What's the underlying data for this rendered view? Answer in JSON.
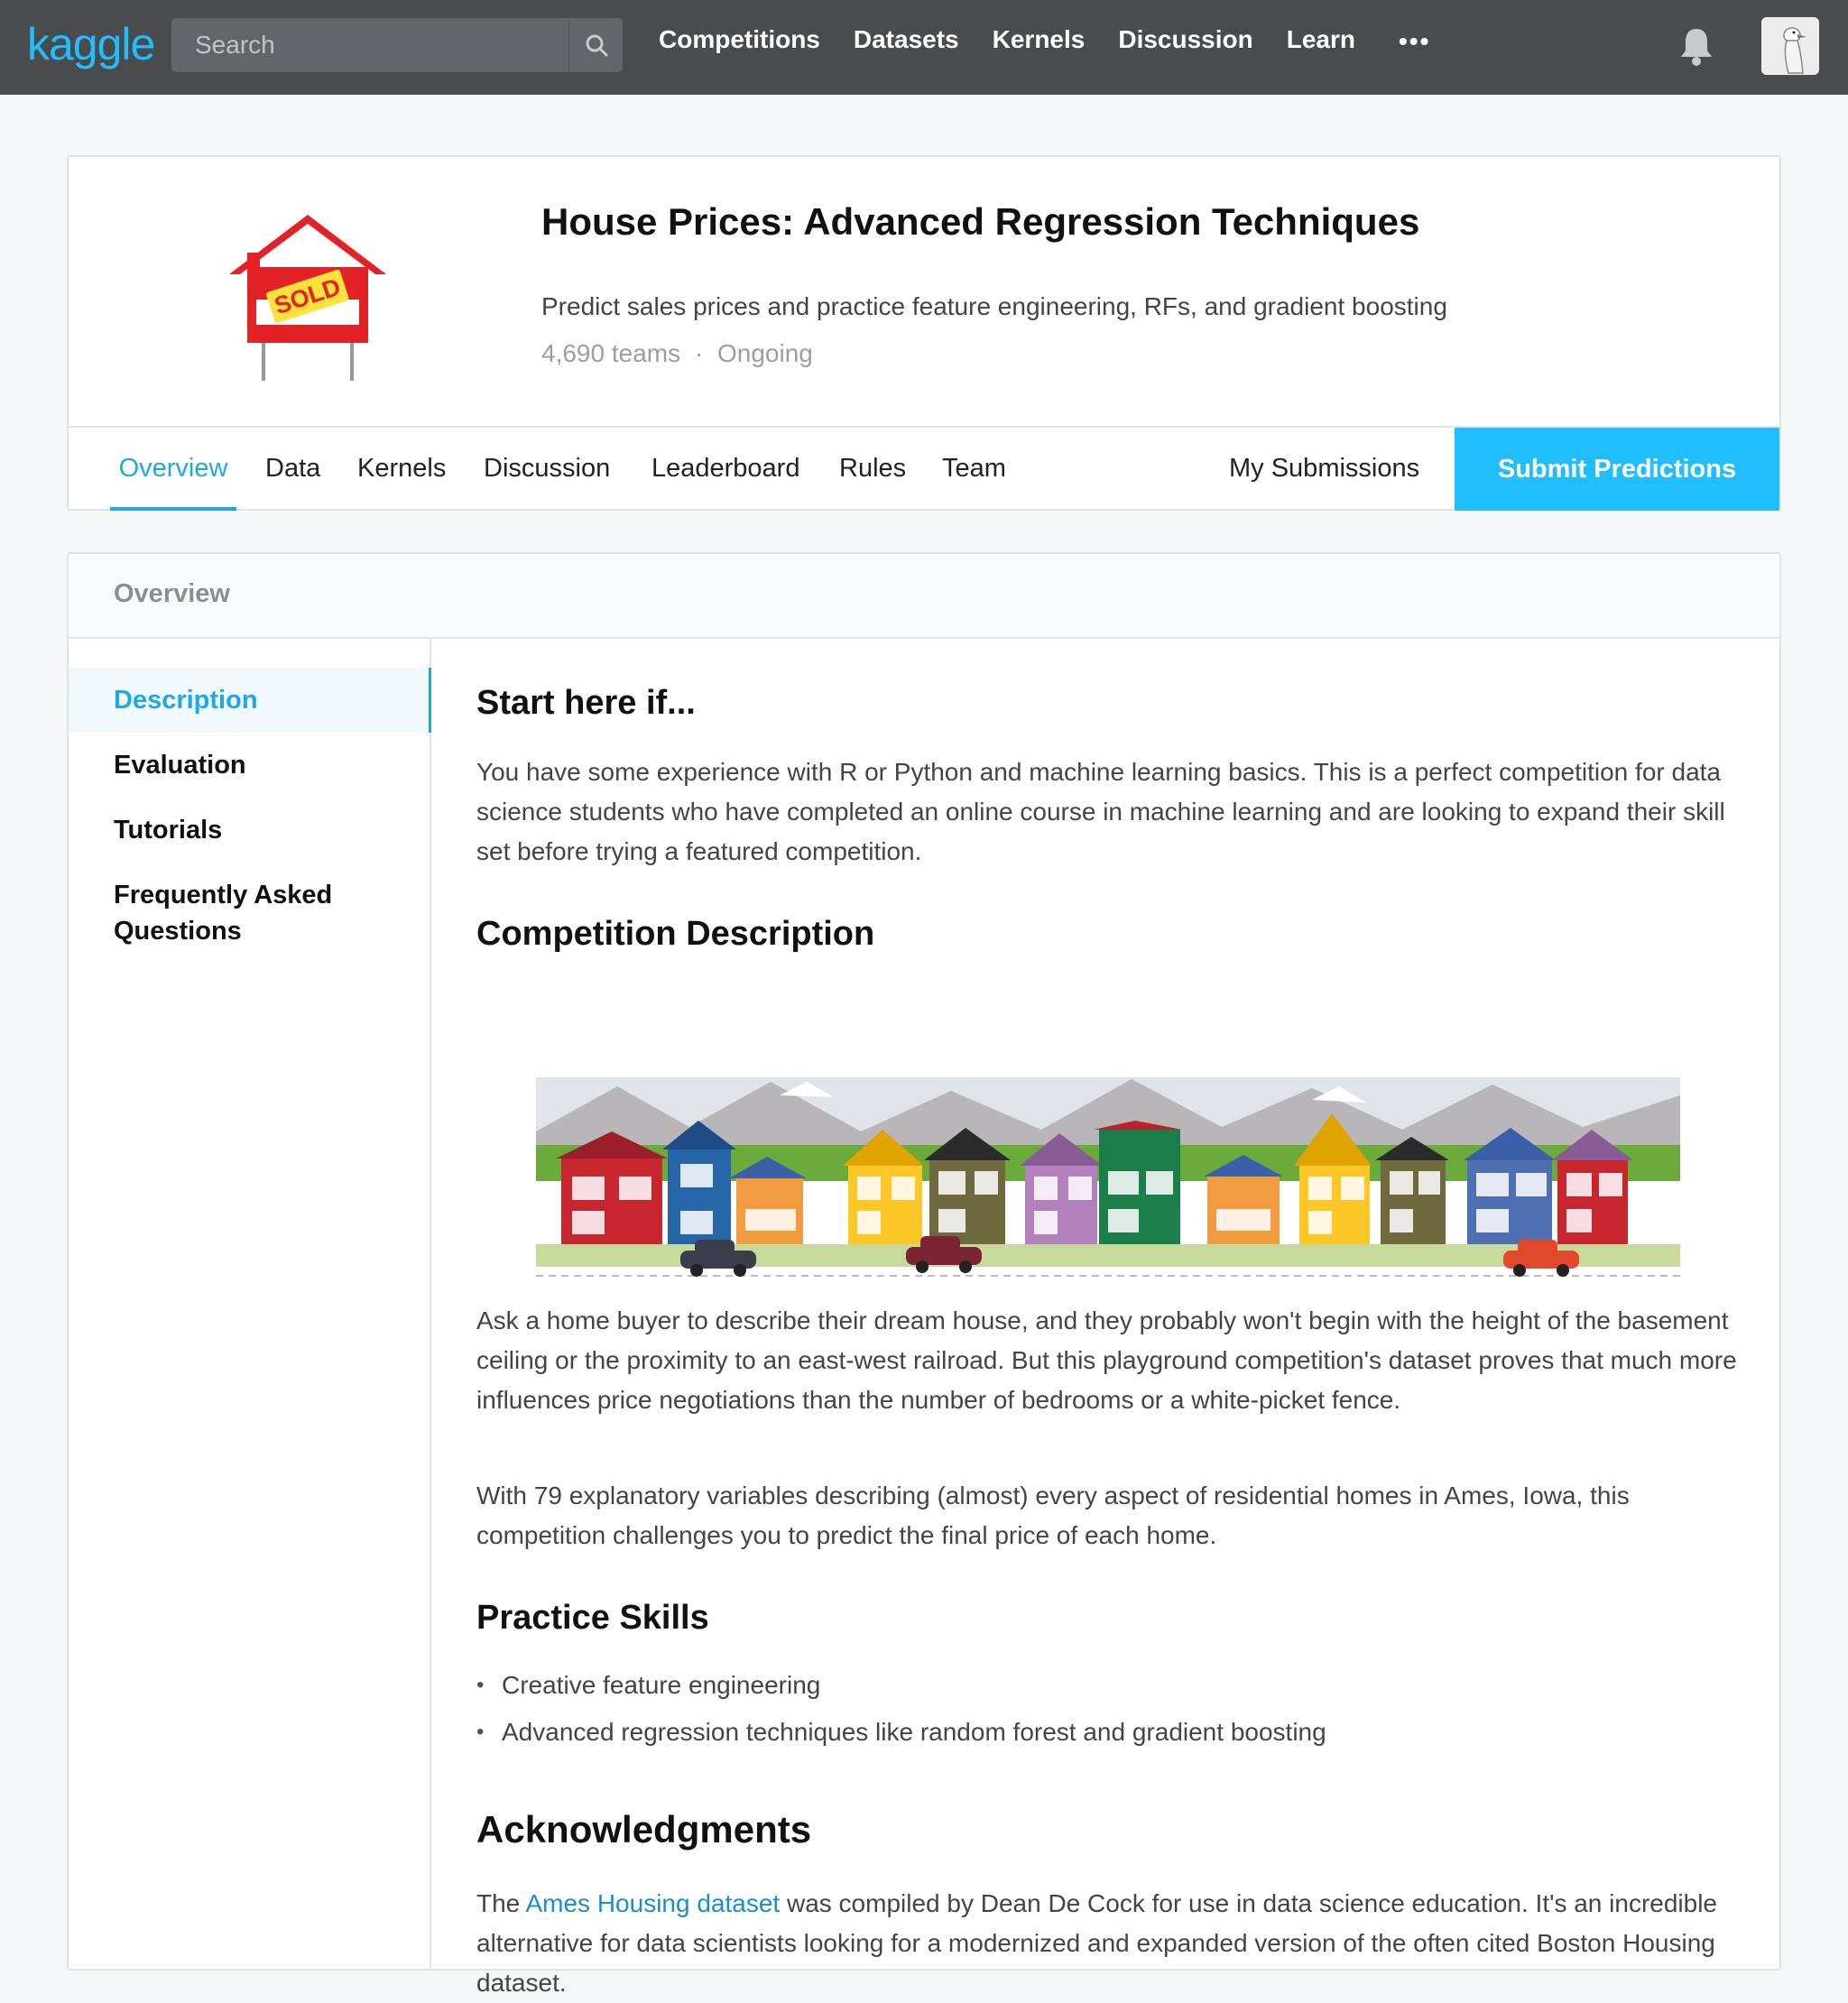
{
  "nav": {
    "logo": "kaggle",
    "search_placeholder": "Search",
    "links": [
      "Competitions",
      "Datasets",
      "Kernels",
      "Discussion",
      "Learn"
    ],
    "more": "•••"
  },
  "competition": {
    "title": "House Prices: Advanced Regression Techniques",
    "subtitle": "Predict sales prices and practice feature engineering, RFs, and gradient boosting",
    "teams": "4,690 teams",
    "separator": "·",
    "status": "Ongoing",
    "logo_text": "SOLD"
  },
  "tabs": {
    "items": [
      "Overview",
      "Data",
      "Kernels",
      "Discussion",
      "Leaderboard",
      "Rules",
      "Team"
    ],
    "my_submissions": "My Submissions",
    "submit": "Submit Predictions"
  },
  "overview": {
    "header": "Overview",
    "sidebar": [
      "Description",
      "Evaluation",
      "Tutorials",
      "Frequently Asked",
      "Questions"
    ],
    "sections": {
      "start_title": "Start here if...",
      "start_text": "You have some experience with R or Python and machine learning basics. This is a perfect competition for data science students who have completed an online course in machine learning and are looking to expand their skill set before trying a featured competition.",
      "desc_title": "Competition Description",
      "desc_p1": "Ask a home buyer to describe their dream house, and they probably won't begin with the height of the basement ceiling or the proximity to an east-west railroad. But this playground competition's dataset proves that much more influences price negotiations than the number of bedrooms or a white-picket fence.",
      "desc_p2": "With 79 explanatory variables describing (almost) every aspect of residential homes in Ames, Iowa, this competition challenges you to predict the final price of each home.",
      "skills_title": "Practice Skills",
      "skills": [
        "Creative feature engineering",
        "Advanced regression techniques like random forest and gradient boosting"
      ],
      "ack_title": "Acknowledgments",
      "ack_pre": "The ",
      "ack_link": "Ames Housing dataset",
      "ack_post": " was compiled by Dean De Cock for use in data science education. It's an incredible alternative for data scientists looking for a modernized and expanded version of the often cited Boston Housing dataset."
    }
  },
  "colors": {
    "topbar": "#4a4b4d",
    "accent": "#20beff",
    "link": "#1b8ec7"
  }
}
